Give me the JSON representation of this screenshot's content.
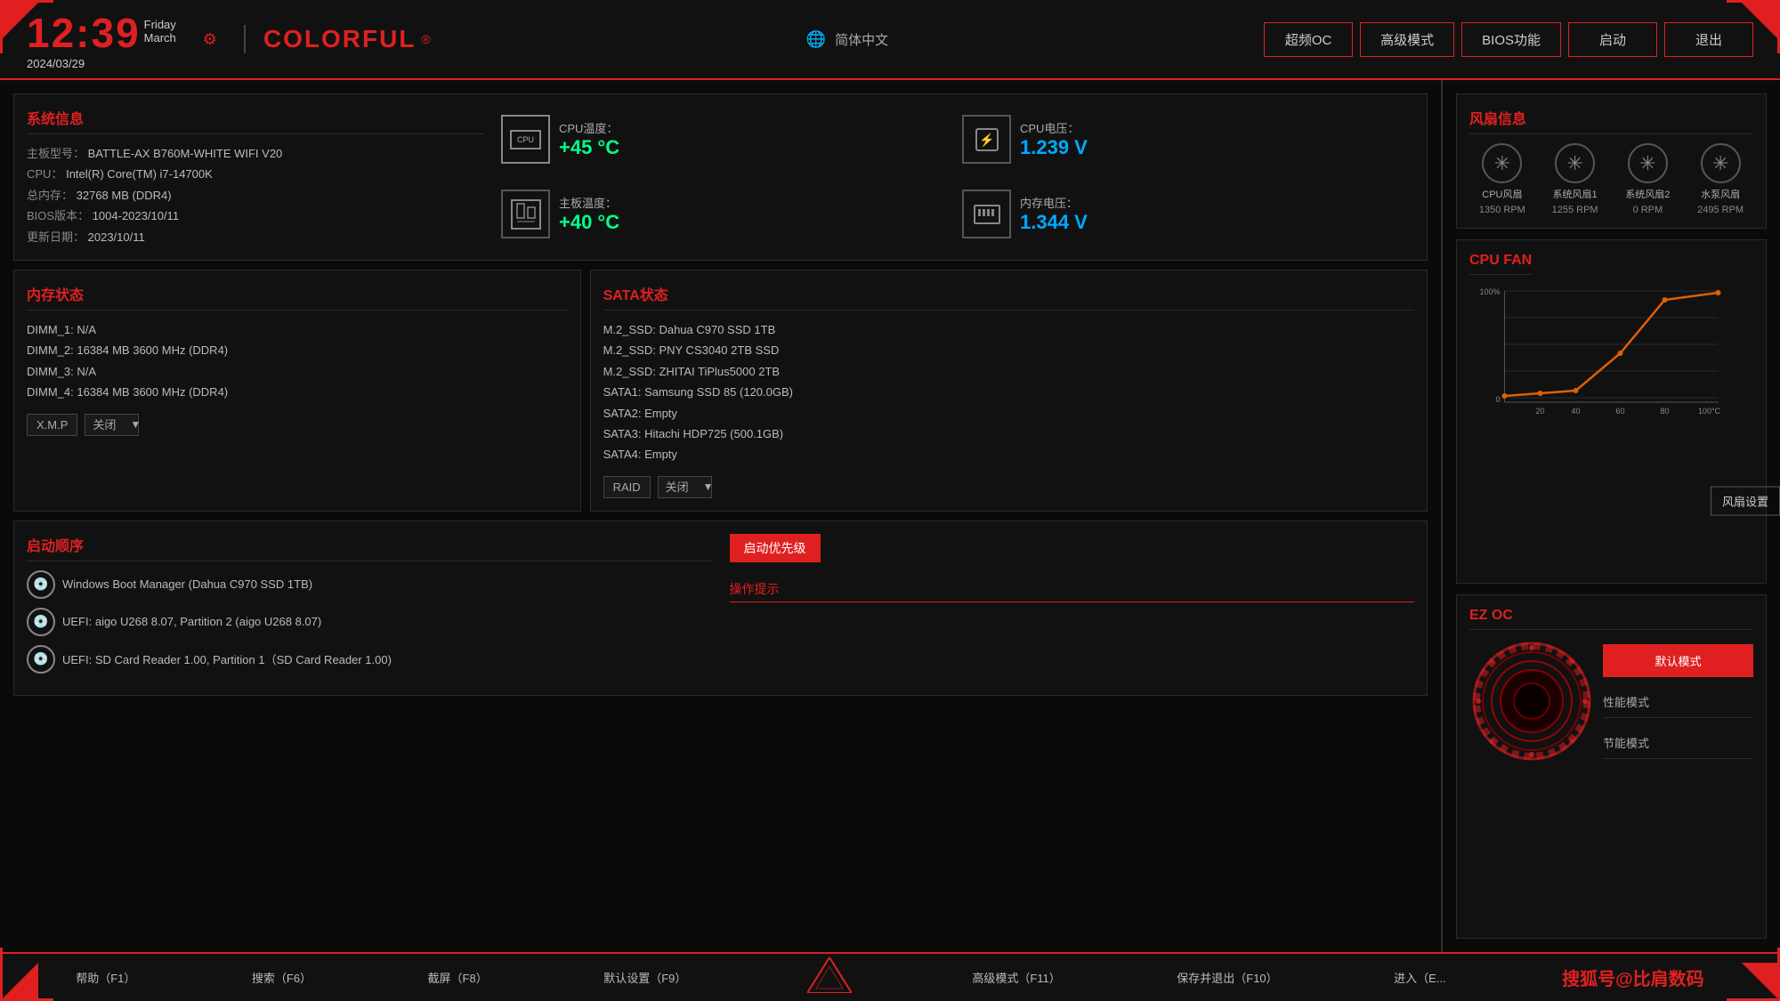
{
  "header": {
    "time": "12:39",
    "date": "2024/03/29",
    "day": "Friday",
    "month": "March",
    "brand": "COLORFUL",
    "language": "简体中文",
    "nav": {
      "oc": "超频OC",
      "advanced": "高级模式",
      "bios": "BIOS功能",
      "boot": "启动",
      "exit": "退出"
    }
  },
  "sysinfo": {
    "title": "系统信息",
    "motherboard_label": "主板型号：",
    "motherboard_value": "BATTLE-AX B760M-WHITE WIFI V20",
    "cpu_label": "CPU：",
    "cpu_value": "Intel(R) Core(TM) i7-14700K",
    "ram_label": "总内存：",
    "ram_value": "32768 MB (DDR4)",
    "bios_label": "BIOS版本：",
    "bios_value": "1004-2023/10/11",
    "update_label": "更新日期：",
    "update_value": "2023/10/11",
    "cpu_temp_label": "CPU温度：",
    "cpu_temp_value": "+45 °C",
    "board_temp_label": "主板温度：",
    "board_temp_value": "+40 °C",
    "cpu_volt_label": "CPU电压：",
    "cpu_volt_value": "1.239 V",
    "mem_volt_label": "内存电压：",
    "mem_volt_value": "1.344 V"
  },
  "memory": {
    "title": "内存状态",
    "dimm1": "DIMM_1: N/A",
    "dimm2": "DIMM_2: 16384 MB  3600 MHz (DDR4)",
    "dimm3": "DIMM_3: N/A",
    "dimm4": "DIMM_4: 16384 MB  3600 MHz (DDR4)",
    "xmp_label": "X.M.P",
    "xmp_value": "关闭"
  },
  "sata": {
    "title": "SATA状态",
    "m2_1": "M.2_SSD: Dahua C970 SSD 1TB",
    "m2_2": "M.2_SSD: PNY CS3040 2TB SSD",
    "m2_3": "M.2_SSD: ZHITAI TiPlus5000 2TB",
    "sata1": "SATA1: Samsung SSD 85 (120.0GB)",
    "sata2": "SATA2: Empty",
    "sata3": "SATA3: Hitachi HDP725 (500.1GB)",
    "sata4": "SATA4: Empty",
    "raid_label": "RAID",
    "raid_value": "关闭"
  },
  "boot": {
    "section_title": "启动顺序",
    "priority_title": "启动优先级",
    "item1": "Windows Boot Manager (Dahua C970 SSD 1TB)",
    "item2": "UEFI: aigo U268 8.07, Partition 2 (aigo U268 8.07)",
    "item3": "UEFI:  SD Card Reader 1.00, Partition 1（SD Card Reader 1.00)",
    "hint_label": "操作提示"
  },
  "fan_info": {
    "title": "风扇信息",
    "fan1_name": "CPU风扇",
    "fan1_rpm": "1350 RPM",
    "fan2_name": "系统风扇1",
    "fan2_rpm": "1255 RPM",
    "fan3_name": "系统风扇2",
    "fan3_rpm": "0 RPM",
    "fan4_name": "水泵风扇",
    "fan4_rpm": "2495 RPM"
  },
  "cpu_fan_chart": {
    "title": "CPU FAN",
    "y_max": "100%",
    "y_min": "0",
    "x_labels": [
      "20",
      "40",
      "60",
      "80",
      "100°C"
    ],
    "fan_settings_btn": "风扇设置"
  },
  "ez_oc": {
    "title": "EZ OC",
    "default_btn": "默认模式",
    "performance_label": "性能模式",
    "power_save_label": "节能模式"
  },
  "footer": {
    "help": "帮助（F1）",
    "search": "搜索（F6）",
    "screenshot": "截屏（F8）",
    "default": "默认设置（F9）",
    "advanced_mode": "高级模式（F11）",
    "save_exit": "保存并退出（F10）",
    "enter_exit": "进入（E...",
    "watermark": "搜狐号@比肩数码"
  }
}
